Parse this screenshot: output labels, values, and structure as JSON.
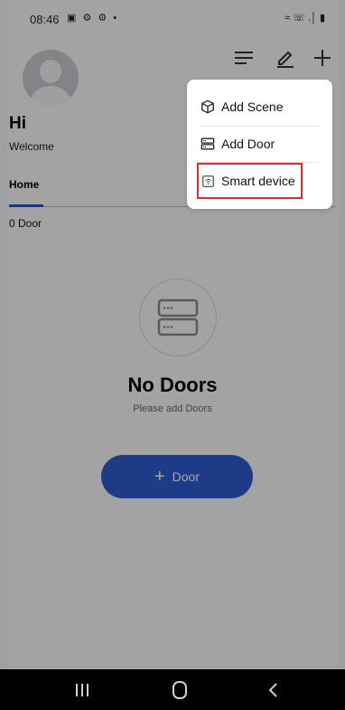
{
  "status_bar": {
    "time": "08:46",
    "left_icons": "▣ ⚙ ⚙ •",
    "right_icons": "≈ ☏ .│ ▮"
  },
  "header": {
    "greeting": "Hi",
    "subtitle": "Welcome"
  },
  "tabs": [
    {
      "label": "Home",
      "active": true
    }
  ],
  "door_count": "0 Door",
  "empty_state": {
    "title": "No Doors",
    "subtitle": "Please add Doors"
  },
  "add_door_button": {
    "plus": "+",
    "label": "Door"
  },
  "popup_menu": {
    "items": [
      {
        "label": "Add Scene",
        "icon": "cube-icon"
      },
      {
        "label": "Add Door",
        "icon": "door-device-icon"
      },
      {
        "label": "Smart device",
        "icon": "wifi-device-icon"
      }
    ]
  },
  "colors": {
    "accent": "#2f5bd0",
    "highlight": "#e02a2a",
    "overlay": "rgba(0,0,0,0.35)"
  }
}
